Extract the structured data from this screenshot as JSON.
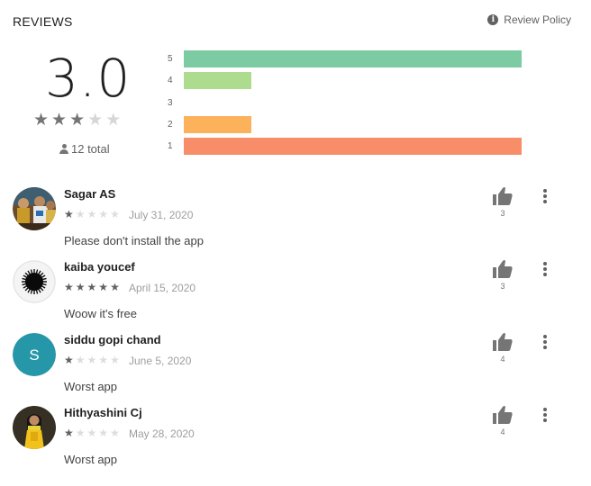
{
  "header": {
    "title": "REVIEWS",
    "policy_label": "Review Policy"
  },
  "summary": {
    "score": "3.0",
    "stars_filled": 3,
    "stars_total": 5,
    "total_label": "12 total"
  },
  "distribution": [
    {
      "label": "5",
      "fraction": 0.95,
      "color": "#7CCBA3"
    },
    {
      "label": "4",
      "fraction": 0.19,
      "color": "#AEDC8E"
    },
    {
      "label": "3",
      "fraction": 0.0,
      "color": "#FFD54F"
    },
    {
      "label": "2",
      "fraction": 0.19,
      "color": "#FBB25A"
    },
    {
      "label": "1",
      "fraction": 0.95,
      "color": "#F88D69"
    }
  ],
  "colors": {
    "star_on": "#757575",
    "star_off": "#d6d6d6",
    "small_star_on": "#616161",
    "small_star_off": "#dddddd",
    "teal_avatar": "#2697a8"
  },
  "reviews": [
    {
      "name": "Sagar AS",
      "stars": 1,
      "date": "July 31, 2020",
      "text": "Please don't install the app",
      "likes": "3",
      "avatar": "photo-group"
    },
    {
      "name": "kaiba youcef",
      "stars": 5,
      "date": "April 15, 2020",
      "text": "Woow it's free",
      "likes": "3",
      "avatar": "black-blob"
    },
    {
      "name": "siddu gopi chand",
      "stars": 1,
      "date": "June 5, 2020",
      "text": "Worst app",
      "likes": "4",
      "avatar": "letter",
      "avatar_letter": "S"
    },
    {
      "name": "Hithyashini Cj",
      "stars": 1,
      "date": "May 28, 2020",
      "text": "Worst app",
      "likes": "4",
      "avatar": "photo-person"
    }
  ]
}
